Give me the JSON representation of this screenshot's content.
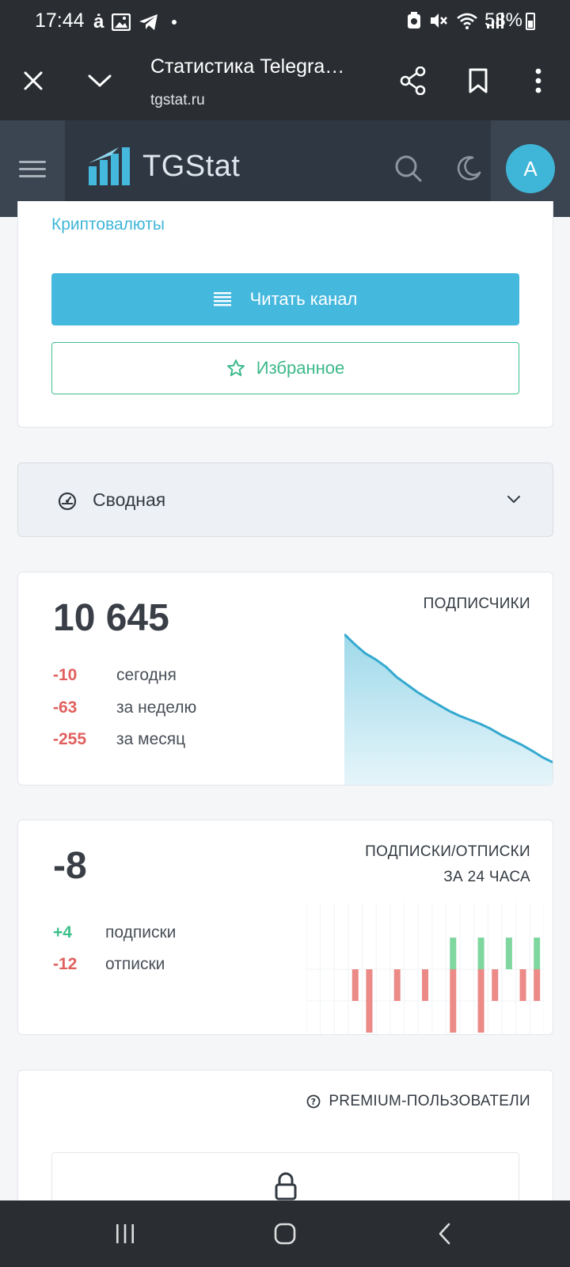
{
  "status_bar": {
    "time": "17:44",
    "battery_percent": "53%",
    "left_icons": [
      "text-a-icon",
      "image-icon",
      "telegram-icon",
      "dot-icon"
    ],
    "right_icons": [
      "recycle-icon",
      "mute-icon",
      "wifi-icon",
      "signal-icon"
    ]
  },
  "browser": {
    "page_title": "Статистика Telegra…",
    "url": "tgstat.ru",
    "buttons": [
      "close-icon",
      "chevron-down-icon",
      "share-icon",
      "bookmark-icon",
      "more-vert-icon"
    ]
  },
  "site_header": {
    "logo_text": "TGStat",
    "avatar_letter": "A",
    "accent_color": "#3fb6d8"
  },
  "channel": {
    "category": "Криптовалюты",
    "read_button": "Читать канал",
    "favorite_button": "Избранное"
  },
  "summary_toggle": {
    "label": "Сводная"
  },
  "subscribers": {
    "total": "10 645",
    "caption": "ПОДПИСЧИКИ",
    "rows": [
      {
        "value": "-10",
        "label": "сегодня"
      },
      {
        "value": "-63",
        "label": "за неделю"
      },
      {
        "value": "-255",
        "label": "за месяц"
      }
    ]
  },
  "daily_flow": {
    "net": "-8",
    "caption_line1": "ПОДПИСКИ/ОТПИСКИ",
    "caption_line2": "ЗА 24 ЧАСА",
    "rows": [
      {
        "value": "+4",
        "label": "подписки"
      },
      {
        "value": "-12",
        "label": "отписки"
      }
    ]
  },
  "premium": {
    "caption": "PREMIUM-ПОЛЬЗОВАТЕЛИ"
  },
  "chart_data": [
    {
      "type": "area",
      "series": [
        {
          "values": [
            10900,
            10880,
            10862,
            10850,
            10835,
            10815,
            10800,
            10785,
            10772,
            10760,
            10748,
            10738,
            10730,
            10722,
            10712,
            10700,
            10690,
            10680,
            10668,
            10655,
            10645
          ]
        }
      ]
    },
    {
      "type": "bar",
      "series": [
        {
          "name": "подписки",
          "values": [
            0,
            0,
            0,
            0,
            0,
            0,
            0,
            0,
            0,
            0,
            1,
            0,
            1,
            0,
            1,
            0,
            1
          ]
        },
        {
          "name": "отписки",
          "values": [
            0,
            0,
            0,
            -1,
            -2,
            0,
            -1,
            0,
            -1,
            0,
            -2,
            0,
            -2,
            -1,
            0,
            -1,
            -1
          ]
        }
      ]
    }
  ]
}
